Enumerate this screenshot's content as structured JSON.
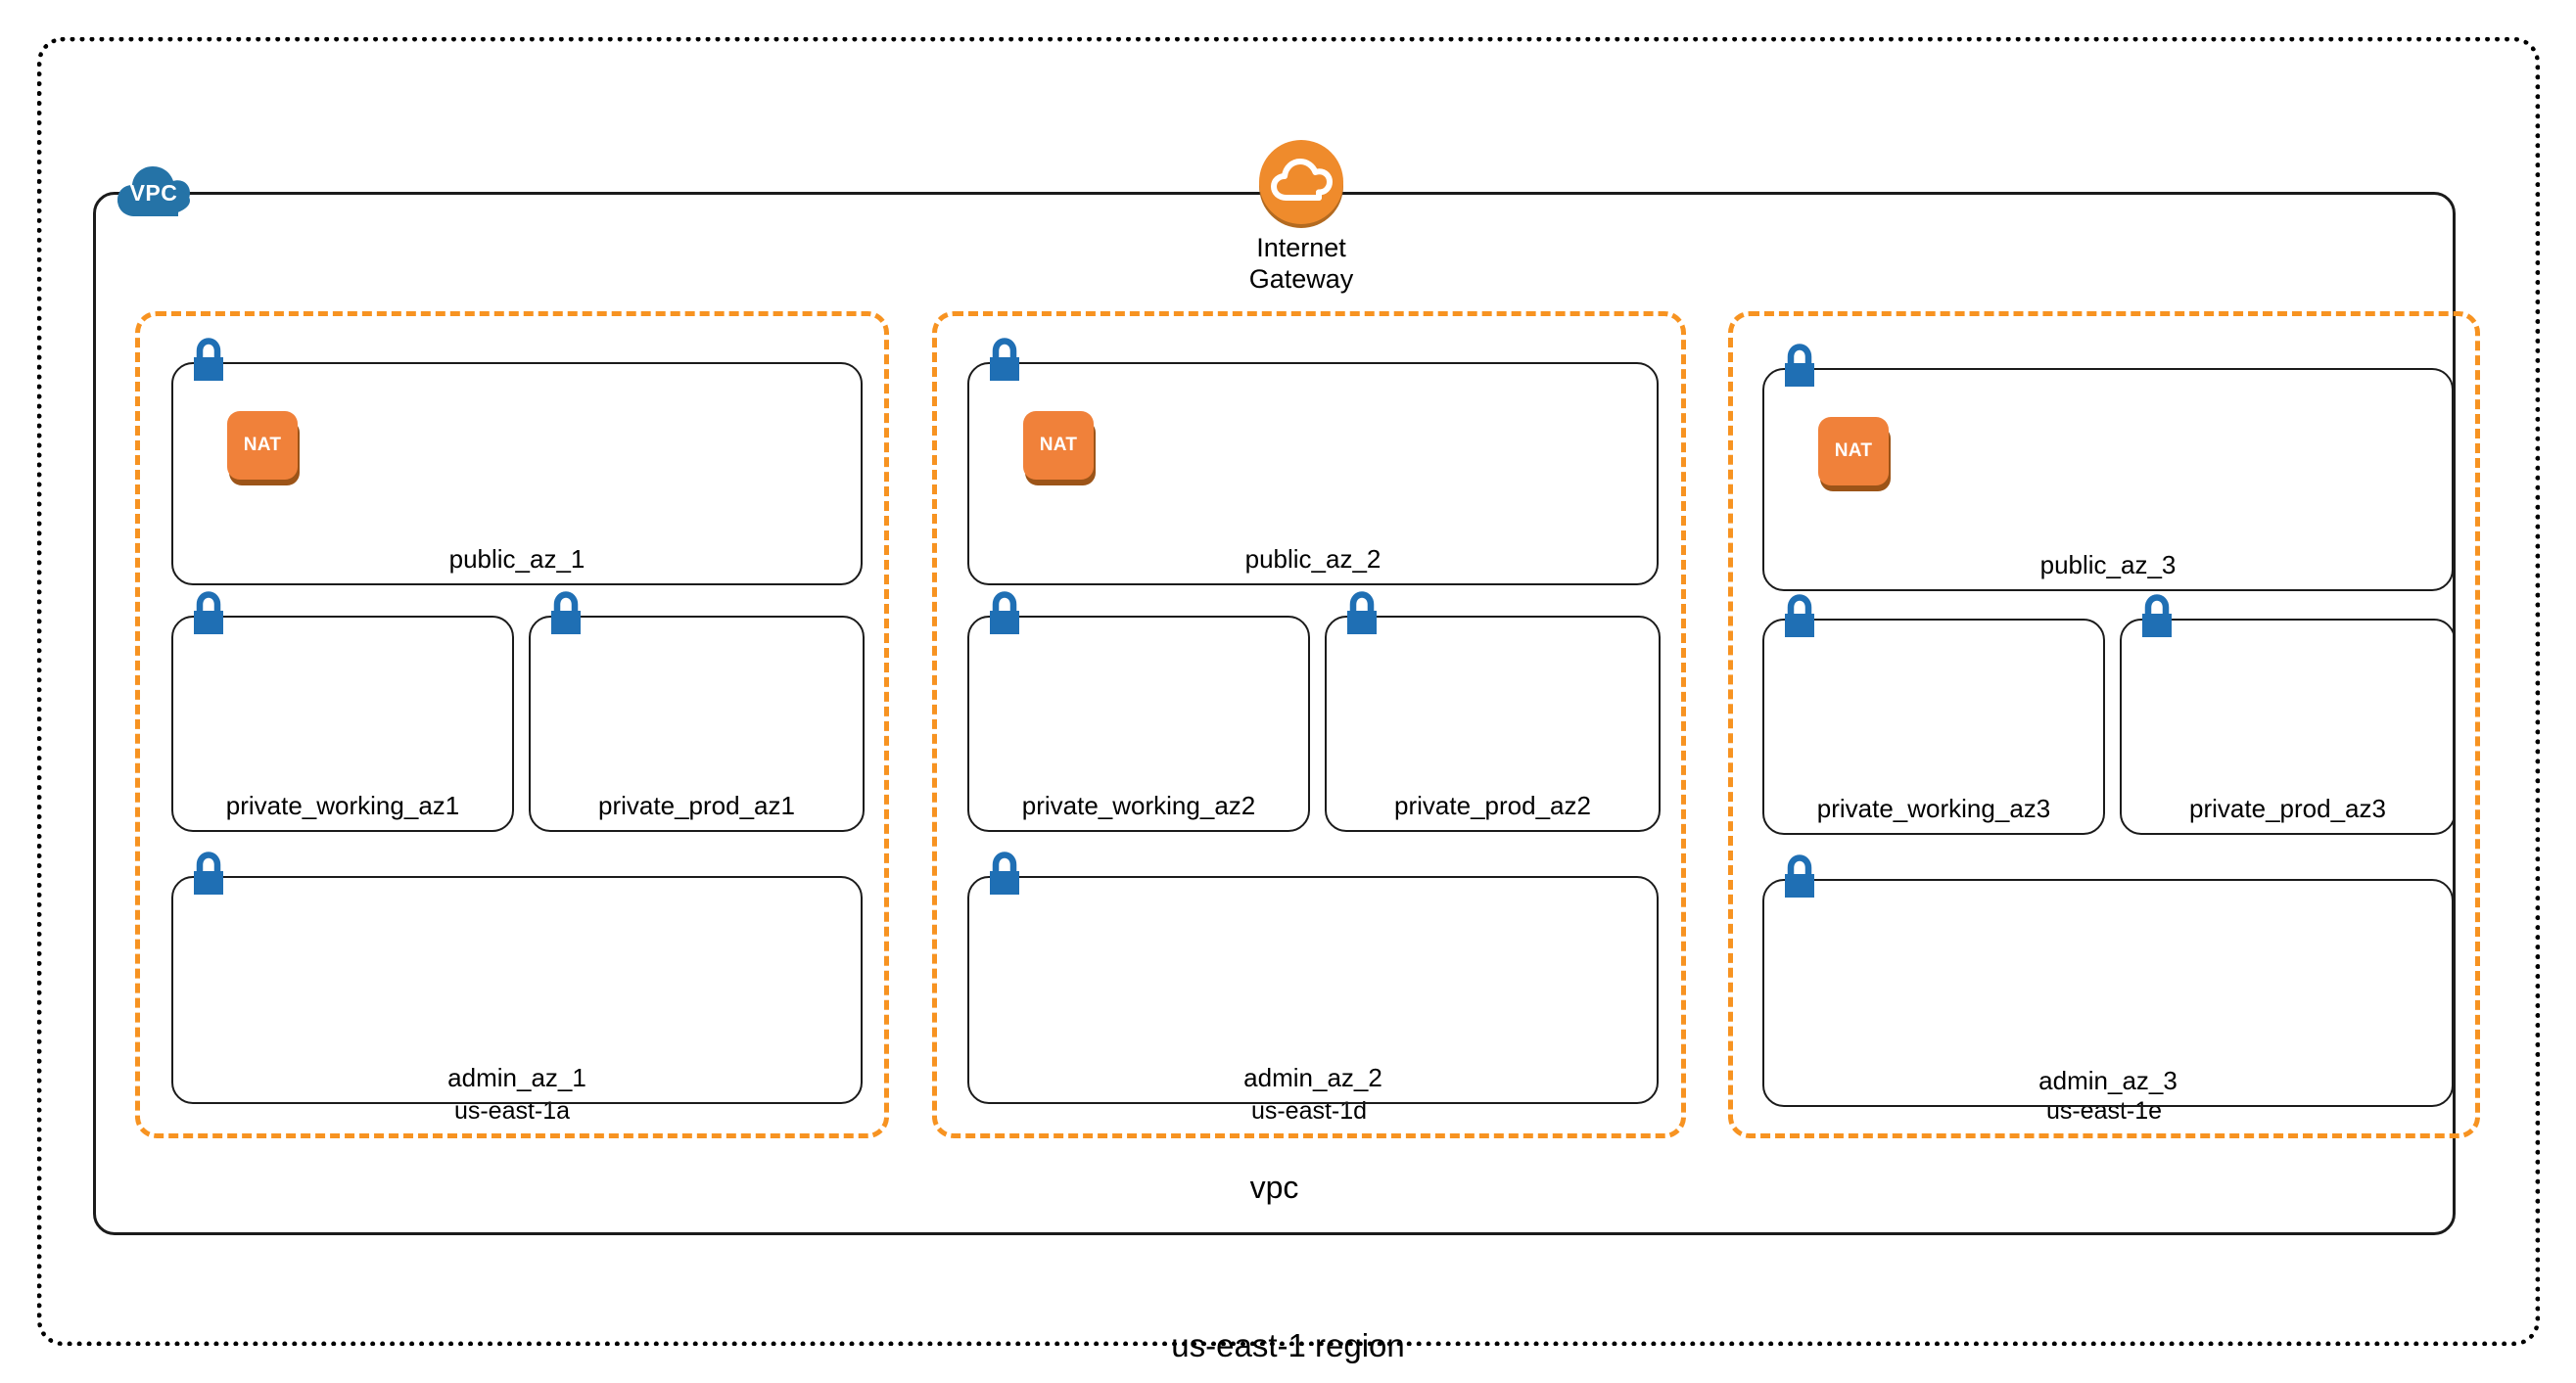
{
  "region": {
    "label": "us-east-1 region"
  },
  "vpc": {
    "label": "vpc",
    "badge_text": "VPC"
  },
  "internet_gateway": {
    "label_line1": "Internet",
    "label_line2": "Gateway",
    "icon": "cloud-icon"
  },
  "nat": {
    "label": "NAT"
  },
  "colors": {
    "az_border": "#f79321",
    "nat_fill": "#f0813a",
    "nat_shadow": "#9c5418",
    "igw_fill": "#ef8b2c",
    "igw_shadow": "#b36a20",
    "lock_fill": "#1f6fb4",
    "vpc_cloud": "#2573a7",
    "box_border": "#1b1b1b"
  },
  "availability_zones": [
    {
      "id": "az1",
      "label": "us-east-1a",
      "public_subnet": {
        "label": "public_az_1",
        "has_nat": true
      },
      "private_subnets": [
        {
          "label": "private_working_az1"
        },
        {
          "label": "private_prod_az1"
        }
      ],
      "admin_subnet": {
        "label": "admin_az_1"
      }
    },
    {
      "id": "az2",
      "label": "us-east-1d",
      "public_subnet": {
        "label": "public_az_2",
        "has_nat": true
      },
      "private_subnets": [
        {
          "label": "private_working_az2"
        },
        {
          "label": "private_prod_az2"
        }
      ],
      "admin_subnet": {
        "label": "admin_az_2"
      }
    },
    {
      "id": "az3",
      "label": "us-east-1e",
      "public_subnet": {
        "label": "public_az_3",
        "has_nat": true
      },
      "private_subnets": [
        {
          "label": "private_working_az3"
        },
        {
          "label": "private_prod_az3"
        }
      ],
      "admin_subnet": {
        "label": "admin_az_3"
      }
    }
  ]
}
